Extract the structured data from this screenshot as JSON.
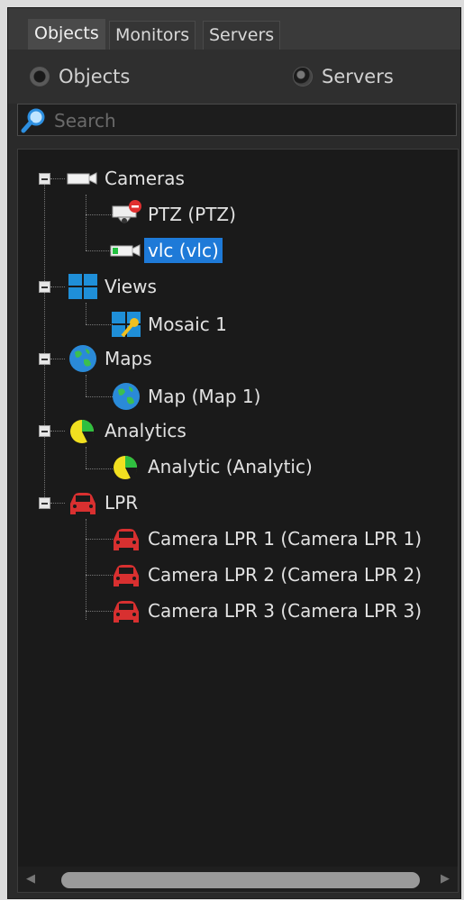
{
  "tabs": [
    {
      "label": "Objects",
      "active": true
    },
    {
      "label": "Monitors",
      "active": false
    },
    {
      "label": "Servers",
      "active": false
    }
  ],
  "mode": {
    "options": [
      {
        "label": "Objects",
        "selected": true
      },
      {
        "label": "Servers",
        "selected": false
      }
    ]
  },
  "search": {
    "placeholder": "Search",
    "value": ""
  },
  "tree": {
    "groups": [
      {
        "label": "Cameras",
        "icon": "camera-icon",
        "children": [
          {
            "label": "PTZ (PTZ)",
            "icon": "ptz-camera-blocked-icon"
          },
          {
            "label": "vlc (vlc)",
            "icon": "camera-green-icon",
            "selected": true
          }
        ]
      },
      {
        "label": "Views",
        "icon": "views-grid-icon",
        "children": [
          {
            "label": "Mosaic 1",
            "icon": "mosaic-key-icon"
          }
        ]
      },
      {
        "label": "Maps",
        "icon": "globe-icon",
        "children": [
          {
            "label": "Map (Map 1)",
            "icon": "globe-icon"
          }
        ]
      },
      {
        "label": "Analytics",
        "icon": "pie-chart-icon",
        "children": [
          {
            "label": "Analytic (Analytic)",
            "icon": "pie-chart-icon"
          }
        ]
      },
      {
        "label": "LPR",
        "icon": "car-icon",
        "children": [
          {
            "label": "Camera LPR 1 (Camera LPR 1)",
            "icon": "car-icon"
          },
          {
            "label": "Camera LPR 2 (Camera LPR 2)",
            "icon": "car-icon"
          },
          {
            "label": "Camera LPR 3 (Camera LPR 3)",
            "icon": "car-icon"
          }
        ]
      }
    ]
  },
  "colors": {
    "selection": "#1e7ad8",
    "background": "#1a1a1a",
    "text": "#e2e2e2"
  }
}
